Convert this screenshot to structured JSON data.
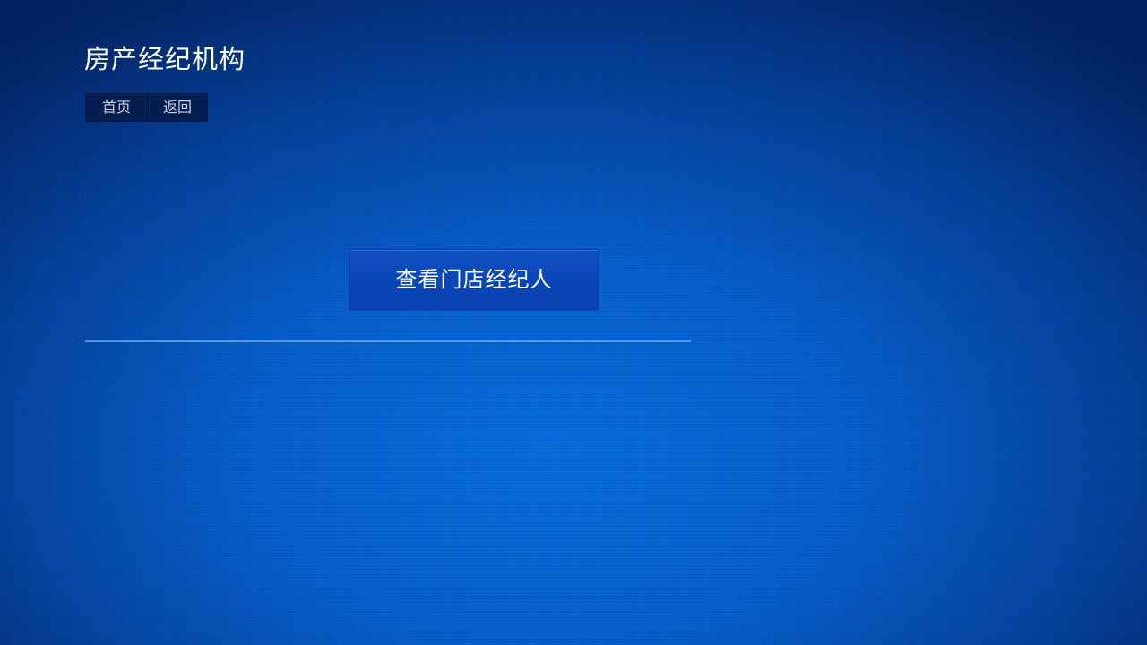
{
  "header": {
    "title": "房产经纪机构"
  },
  "nav": {
    "home_label": "首页",
    "back_label": "返回"
  },
  "main": {
    "view_agents_label": "查看门店经纪人"
  },
  "colors": {
    "background_center": "#086ee1",
    "background_edge": "#03286e",
    "button_fill": "#0a46b6",
    "nav_fill": "#05194a",
    "divider": "#78aaf0"
  }
}
